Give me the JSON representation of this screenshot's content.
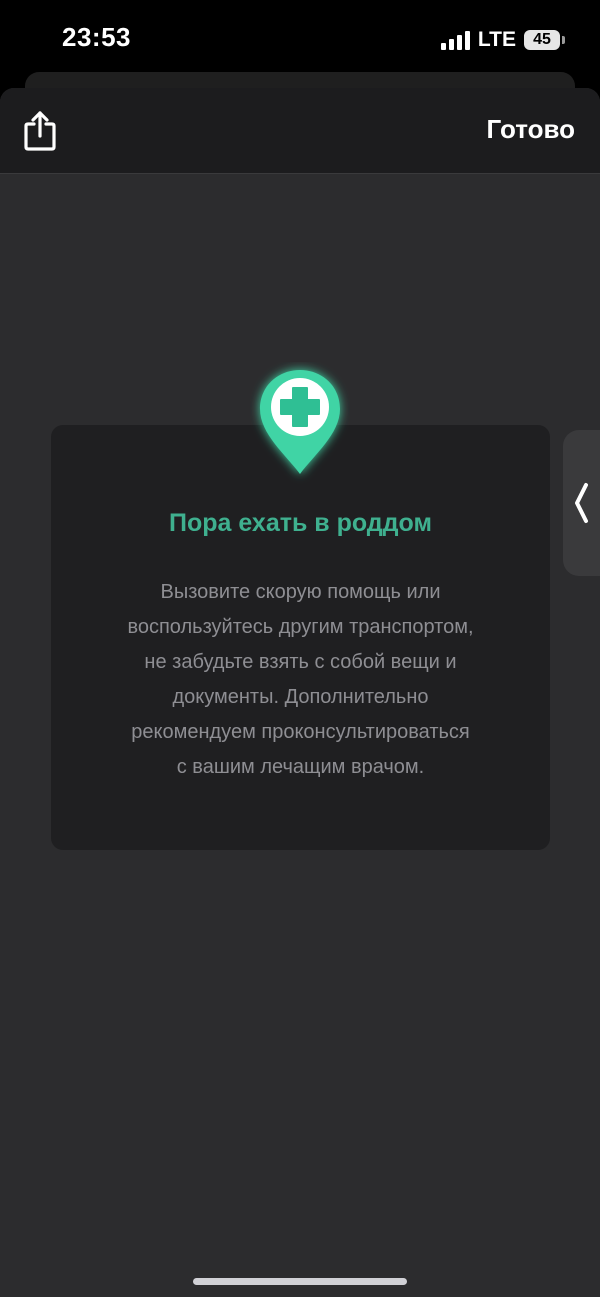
{
  "status_bar": {
    "time": "23:53",
    "network": "LTE",
    "battery": "45"
  },
  "nav": {
    "done_label": "Готово",
    "share_icon": "share-icon"
  },
  "card": {
    "icon": "medical-location-pin-icon",
    "title": "Пора ехать в роддом",
    "text_lines": [
      "Вызовите скорую помощь или",
      "воспользуйтесь другим транспортом,",
      "не забудьте взять с собой вещи и",
      "документы. Дополнительно",
      "рекомендуем проконсультироваться",
      "с вашим лечащим врачом."
    ]
  },
  "side_handle": {
    "icon": "chevron-left-icon"
  },
  "colors": {
    "accent": "#3fb08f",
    "sheet_background": "#2c2c2e",
    "card_background": "#1f1f21",
    "text_muted": "#8e8e93"
  }
}
